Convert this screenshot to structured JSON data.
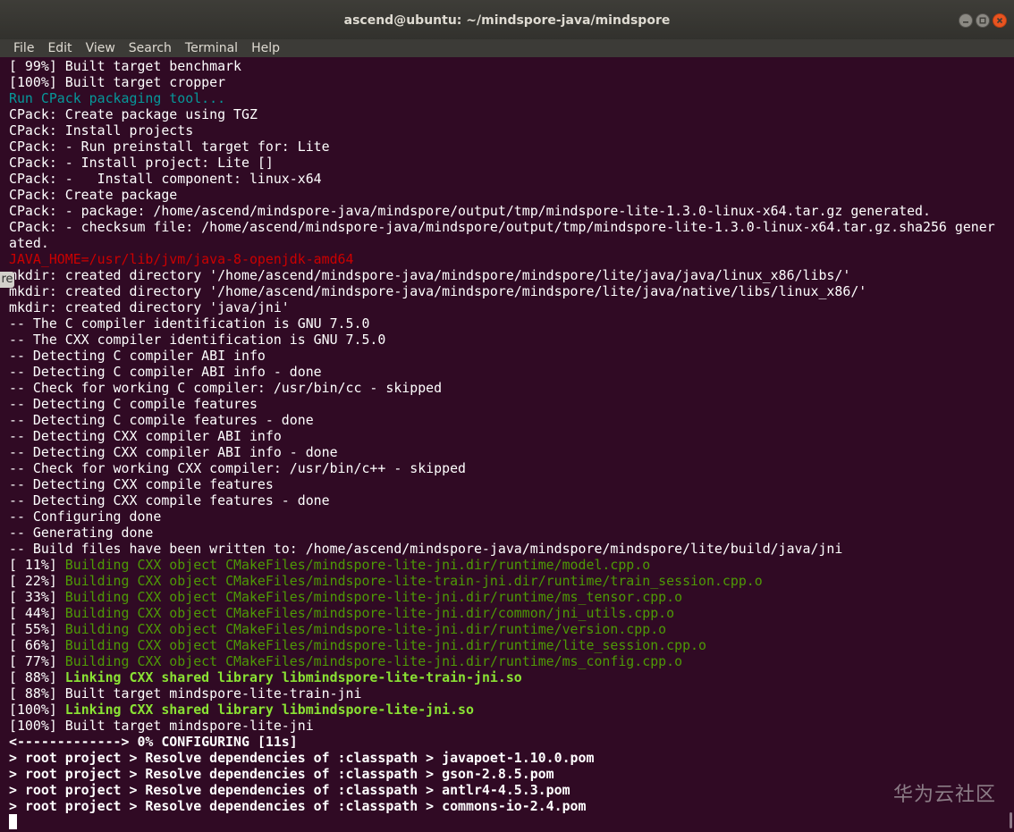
{
  "window": {
    "title": "ascend@ubuntu: ~/mindspore-java/mindspore",
    "controls": [
      "minimize-icon",
      "maximize-icon",
      "close-icon"
    ]
  },
  "menubar": {
    "items": [
      "File",
      "Edit",
      "View",
      "Search",
      "Terminal",
      "Help"
    ]
  },
  "side_tab": {
    "text": "re"
  },
  "watermark": {
    "text": "华为云社区"
  },
  "colors": {
    "background": "#300a24",
    "text": "#ffffff",
    "cyan": "#06989a",
    "red": "#cc0000",
    "green": "#4e9a06",
    "light_green": "#8ae234"
  },
  "terminal": {
    "lines": [
      {
        "text": "[ 99%] Built target benchmark",
        "style": "white"
      },
      {
        "text": "[100%] Built target cropper",
        "style": "white"
      },
      {
        "text": "Run CPack packaging tool...",
        "style": "cyan"
      },
      {
        "text": "CPack: Create package using TGZ",
        "style": "white"
      },
      {
        "text": "CPack: Install projects",
        "style": "white"
      },
      {
        "text": "CPack: - Run preinstall target for: Lite",
        "style": "white"
      },
      {
        "text": "CPack: - Install project: Lite []",
        "style": "white"
      },
      {
        "text": "CPack: -   Install component: linux-x64",
        "style": "white"
      },
      {
        "text": "CPack: Create package",
        "style": "white"
      },
      {
        "text": "CPack: - package: /home/ascend/mindspore-java/mindspore/output/tmp/mindspore-lite-1.3.0-linux-x64.tar.gz generated.",
        "style": "white"
      },
      {
        "text": "CPack: - checksum file: /home/ascend/mindspore-java/mindspore/output/tmp/mindspore-lite-1.3.0-linux-x64.tar.gz.sha256 gener",
        "style": "white"
      },
      {
        "text": "ated.",
        "style": "white"
      },
      {
        "text": "JAVA_HOME=/usr/lib/jvm/java-8-openjdk-amd64",
        "style": "red"
      },
      {
        "text": "mkdir: created directory '/home/ascend/mindspore-java/mindspore/mindspore/lite/java/java/linux_x86/libs/'",
        "style": "white"
      },
      {
        "text": "mkdir: created directory '/home/ascend/mindspore-java/mindspore/mindspore/lite/java/native/libs/linux_x86/'",
        "style": "white"
      },
      {
        "text": "mkdir: created directory 'java/jni'",
        "style": "white"
      },
      {
        "text": "-- The C compiler identification is GNU 7.5.0",
        "style": "white"
      },
      {
        "text": "-- The CXX compiler identification is GNU 7.5.0",
        "style": "white"
      },
      {
        "text": "-- Detecting C compiler ABI info",
        "style": "white"
      },
      {
        "text": "-- Detecting C compiler ABI info - done",
        "style": "white"
      },
      {
        "text": "-- Check for working C compiler: /usr/bin/cc - skipped",
        "style": "white"
      },
      {
        "text": "-- Detecting C compile features",
        "style": "white"
      },
      {
        "text": "-- Detecting C compile features - done",
        "style": "white"
      },
      {
        "text": "-- Detecting CXX compiler ABI info",
        "style": "white"
      },
      {
        "text": "-- Detecting CXX compiler ABI info - done",
        "style": "white"
      },
      {
        "text": "-- Check for working CXX compiler: /usr/bin/c++ - skipped",
        "style": "white"
      },
      {
        "text": "-- Detecting CXX compile features",
        "style": "white"
      },
      {
        "text": "-- Detecting CXX compile features - done",
        "style": "white"
      },
      {
        "text": "-- Configuring done",
        "style": "white"
      },
      {
        "text": "-- Generating done",
        "style": "white"
      },
      {
        "text": "-- Build files have been written to: /home/ascend/mindspore-java/mindspore/mindspore/lite/build/java/jni",
        "style": "white"
      },
      {
        "prefix": "[ 11%] ",
        "text": "Building CXX object CMakeFiles/mindspore-lite-jni.dir/runtime/model.cpp.o",
        "style": "green"
      },
      {
        "prefix": "[ 22%] ",
        "text": "Building CXX object CMakeFiles/mindspore-lite-train-jni.dir/runtime/train_session.cpp.o",
        "style": "green"
      },
      {
        "prefix": "[ 33%] ",
        "text": "Building CXX object CMakeFiles/mindspore-lite-jni.dir/runtime/ms_tensor.cpp.o",
        "style": "green"
      },
      {
        "prefix": "[ 44%] ",
        "text": "Building CXX object CMakeFiles/mindspore-lite-jni.dir/common/jni_utils.cpp.o",
        "style": "green"
      },
      {
        "prefix": "[ 55%] ",
        "text": "Building CXX object CMakeFiles/mindspore-lite-jni.dir/runtime/version.cpp.o",
        "style": "green"
      },
      {
        "prefix": "[ 66%] ",
        "text": "Building CXX object CMakeFiles/mindspore-lite-jni.dir/runtime/lite_session.cpp.o",
        "style": "green"
      },
      {
        "prefix": "[ 77%] ",
        "text": "Building CXX object CMakeFiles/mindspore-lite-jni.dir/runtime/ms_config.cpp.o",
        "style": "green"
      },
      {
        "prefix": "[ 88%] ",
        "text": "Linking CXX shared library libmindspore-lite-train-jni.so",
        "style": "lgreen"
      },
      {
        "text": "[ 88%] Built target mindspore-lite-train-jni",
        "style": "white"
      },
      {
        "prefix": "[100%] ",
        "text": "Linking CXX shared library libmindspore-lite-jni.so",
        "style": "lgreen"
      },
      {
        "text": "[100%] Built target mindspore-lite-jni",
        "style": "white"
      },
      {
        "text": "<-------------> 0% CONFIGURING [11s]",
        "style": "bold"
      },
      {
        "text": "> root project > Resolve dependencies of :classpath > javapoet-1.10.0.pom",
        "style": "bold"
      },
      {
        "text": "> root project > Resolve dependencies of :classpath > gson-2.8.5.pom",
        "style": "bold"
      },
      {
        "text": "> root project > Resolve dependencies of :classpath > antlr4-4.5.3.pom",
        "style": "bold"
      },
      {
        "text": "> root project > Resolve dependencies of :classpath > commons-io-2.4.pom",
        "style": "bold"
      }
    ]
  }
}
